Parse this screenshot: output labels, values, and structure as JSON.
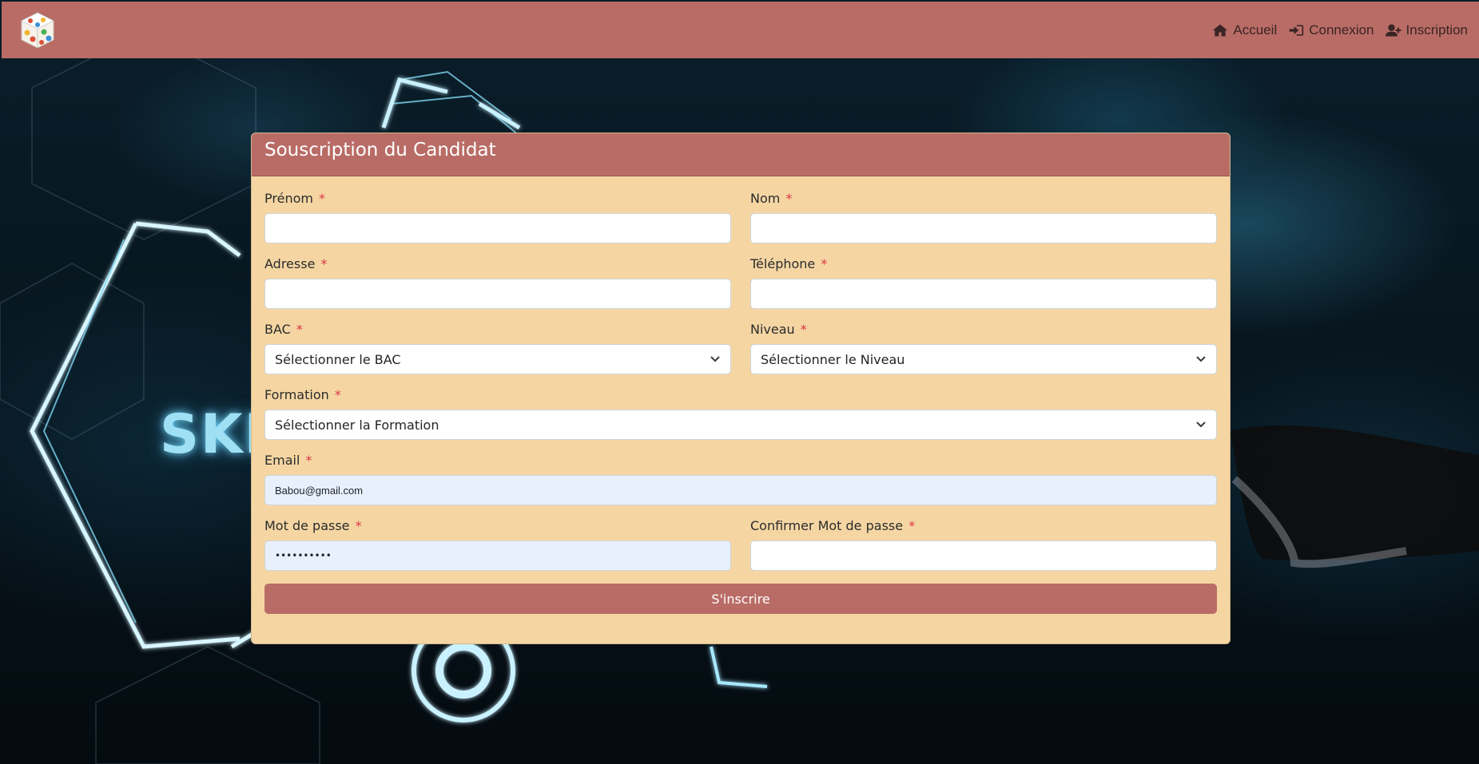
{
  "navbar": {
    "links": [
      {
        "label": "Accueil",
        "icon": "home-icon"
      },
      {
        "label": "Connexion",
        "icon": "sign-in-icon"
      },
      {
        "label": "Inscription",
        "icon": "user-plus-icon"
      }
    ]
  },
  "background": {
    "text": "SKIL"
  },
  "form": {
    "title": "Souscription du Candidat",
    "required_marker": "*",
    "fields": {
      "prenom": {
        "label": "Prénom",
        "value": ""
      },
      "nom": {
        "label": "Nom",
        "value": ""
      },
      "adresse": {
        "label": "Adresse",
        "value": ""
      },
      "telephone": {
        "label": "Téléphone",
        "value": ""
      },
      "bac": {
        "label": "BAC",
        "selected": "Sélectionner le BAC"
      },
      "niveau": {
        "label": "Niveau",
        "selected": "Sélectionner le Niveau"
      },
      "formation": {
        "label": "Formation",
        "selected": "Sélectionner la Formation"
      },
      "email": {
        "label": "Email",
        "value": "Babou@gmail.com"
      },
      "password": {
        "label": "Mot de passe",
        "value": "••••••••••"
      },
      "confirm_password": {
        "label": "Confirmer Mot de passe",
        "value": ""
      }
    },
    "submit_label": "S'inscrire"
  },
  "colors": {
    "brand": "#b96c66",
    "card_bg": "#f5d6a3",
    "required": "#dc3545",
    "autofill_bg": "#e8f0fe"
  }
}
